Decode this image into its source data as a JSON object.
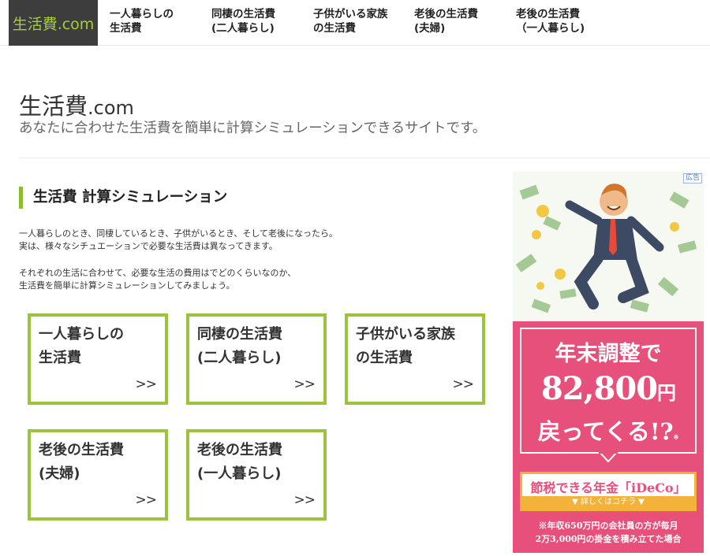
{
  "nav": {
    "logo": "生活費.com",
    "items": [
      {
        "line1": "一人暮らしの",
        "line2": "生活費"
      },
      {
        "line1": "同棲の生活費",
        "line2": "(二人暮らし)"
      },
      {
        "line1": "子供がいる家族",
        "line2": "の生活費"
      },
      {
        "line1": "老後の生活費",
        "line2": "(夫婦)"
      },
      {
        "line1": "老後の生活費",
        "line2": "（一人暮らし)"
      }
    ]
  },
  "header": {
    "title_main": "生活費",
    "title_suffix": ".com",
    "subtitle": "あなたに合わせた生活費を簡単に計算シミュレーションできるサイトです。"
  },
  "section": {
    "heading": "生活費 計算シミュレーション",
    "para1": [
      "一人暮らしのとき、同棲しているとき、子供がいるとき、そして老後になったら。",
      "実は、様々なシチュエーションで必要な生活費は異なってきます。"
    ],
    "para2": [
      "それぞれの生活に合わせて、必要な生活の費用はでどのくらいなのか、",
      "生活費を簡単に計算シミュレーションしてみましょう。"
    ]
  },
  "cards": [
    {
      "line1": "一人暮らしの",
      "line2": "生活費",
      "arrow": ">>"
    },
    {
      "line1": "同棲の生活費",
      "line2": "(二人暮らし)",
      "arrow": ">>"
    },
    {
      "line1": "子供がいる家族",
      "line2": "の生活費",
      "arrow": ">>"
    },
    {
      "line1": "老後の生活費",
      "line2": "(夫婦)",
      "arrow": ">>"
    },
    {
      "line1": "老後の生活費",
      "line2": "(一人暮らし)",
      "arrow": ">>"
    }
  ],
  "ad": {
    "badge": "広告",
    "line1": "年末調整で",
    "line2_num": "82,800",
    "line2_unit": "円",
    "line3": "戻ってくる!?",
    "mark": "※",
    "product": "節税できる年金「iDeCo」",
    "cta": "▼ 詳しくはコチラ ▼",
    "note1": "※年収650万円の会社員の方が毎月",
    "note2": "2万3,000円の掛金を積み立てた場合"
  },
  "colors": {
    "accent": "#8cbb2d",
    "card_border": "#9cc33c",
    "logo_bg": "#3d3d3d",
    "logo_text": "#a5cc3a",
    "ad_pink": "#e6507a",
    "ad_yellow": "#f3b23a"
  }
}
